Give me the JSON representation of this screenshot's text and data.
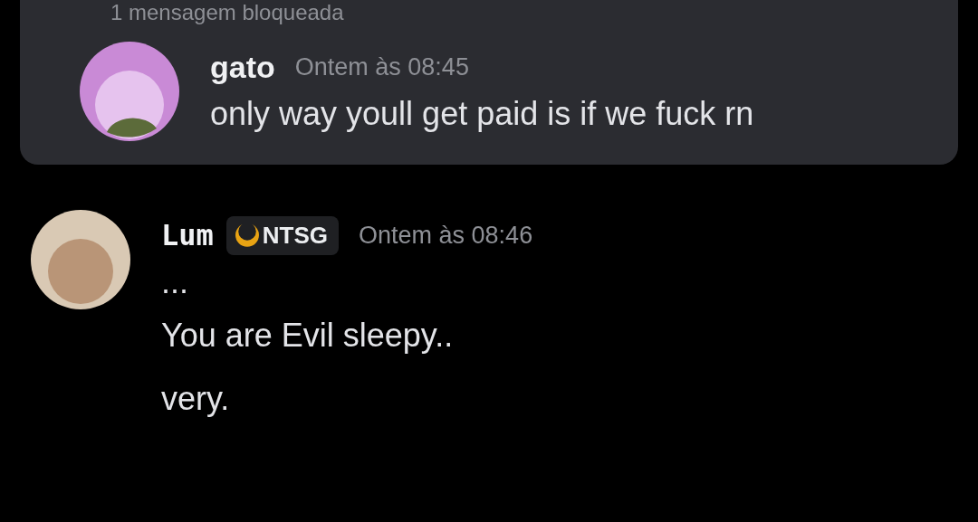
{
  "blocked_notice": {
    "text": "1 mensagem bloqueada"
  },
  "blocked_messages": [
    {
      "author": "gato",
      "timestamp": "Ontem às 08:45",
      "lines": [
        "only way youll get paid is if we fuck rn"
      ]
    }
  ],
  "messages": [
    {
      "author": "Lum",
      "tag": "NTSG",
      "timestamp": "Ontem às 08:46",
      "lines": [
        "...",
        "You are Evil sleepy..",
        "very."
      ]
    }
  ]
}
